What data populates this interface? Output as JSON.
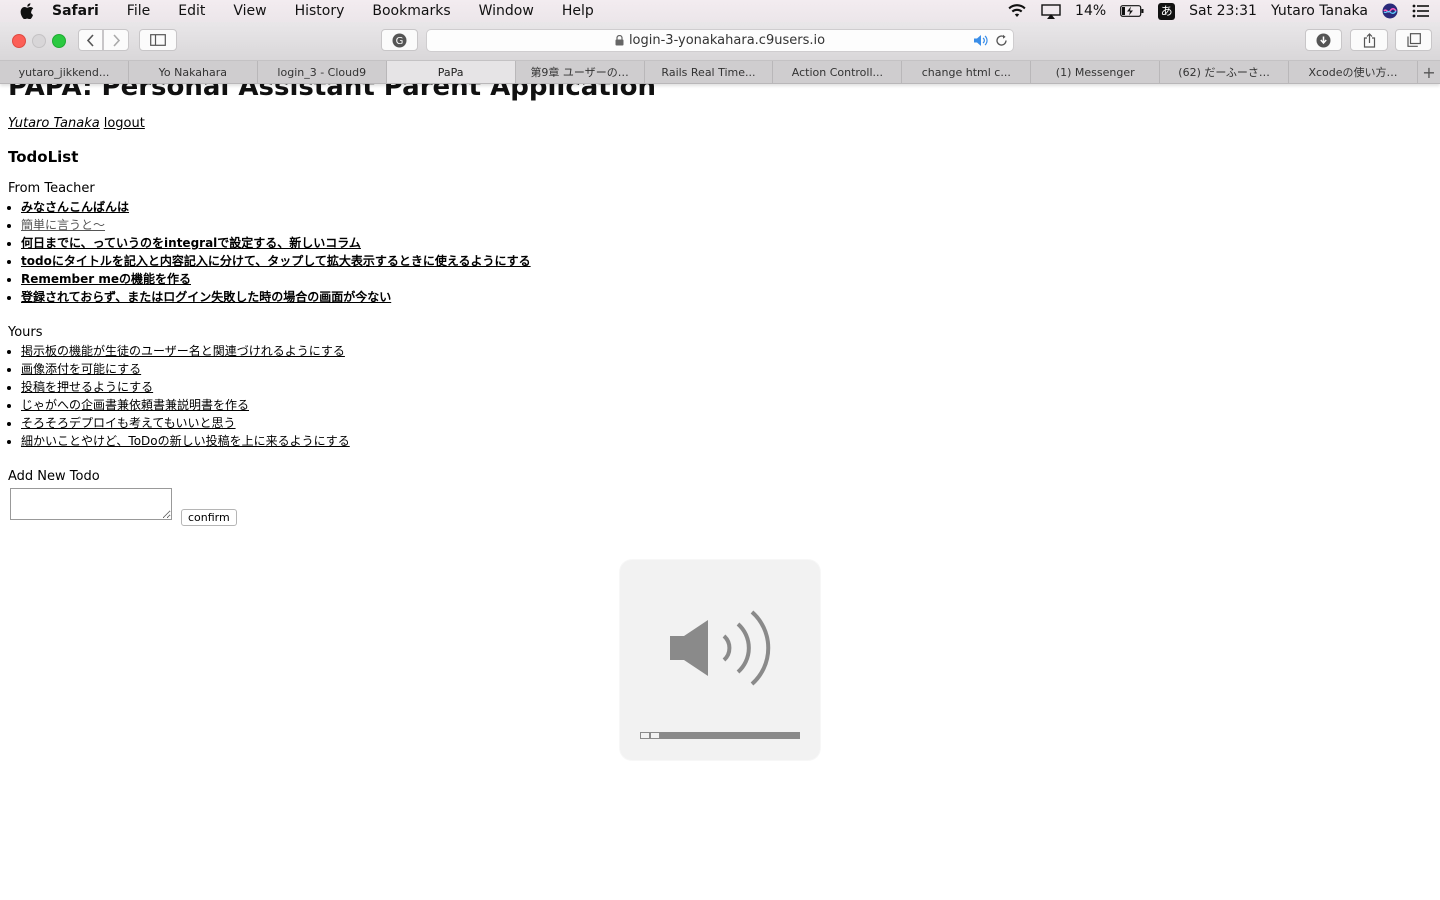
{
  "menubar": {
    "app_name": "Safari",
    "items": [
      "File",
      "Edit",
      "View",
      "History",
      "Bookmarks",
      "Window",
      "Help"
    ],
    "battery": "14%",
    "input_method": "あ",
    "clock": "Sat 23:31",
    "user": "Yutaro Tanaka"
  },
  "browser": {
    "url": "login-3-yonakahara.c9users.io",
    "tabs": [
      {
        "label": "yutaro_jikkend..."
      },
      {
        "label": "Yo Nakahara"
      },
      {
        "label": "login_3 - Cloud9"
      },
      {
        "label": "PaPa"
      },
      {
        "label": "第9章 ユーザーの…"
      },
      {
        "label": "Rails Real Time..."
      },
      {
        "label": "Action Controll..."
      },
      {
        "label": "change html c..."
      },
      {
        "label": "(1) Messenger"
      },
      {
        "label": "(62) だーふーさ…"
      },
      {
        "label": "Xcodeの使い方…"
      }
    ],
    "active_tab": 3,
    "add_tab": "+"
  },
  "page": {
    "title": "PAPA: Personal Assistant Parent Application",
    "user_link": "Yutaro Tanaka",
    "logout_link": "logout",
    "section_title": "TodoList",
    "from_teacher_label": "From Teacher",
    "teacher_todos": [
      "みなさんこんばんは",
      "簡単に言うと〜",
      "何日までに、っていうのをintegralで設定する、新しいコラム",
      "todoにタイトルを記入と内容記入に分けて、タップして拡大表示するときに使えるようにする",
      "Remember meの機能を作る",
      "登録されておらず、またはログイン失敗した時の場合の画面が今ない"
    ],
    "yours_label": "Yours",
    "your_todos": [
      "掲示板の機能が生徒のユーザー名と関連づけれるようにする",
      "画像添付を可能にする",
      "投稿を押せるようにする",
      "じゃがへの企画書兼依頼書兼説明書を作る",
      "そろそろデプロイも考えてもいいと思う",
      "細かいことやけど、ToDoの新しい投稿を上に来るようにする"
    ],
    "add_label": "Add New Todo",
    "new_todo_value": "",
    "confirm_label": "confirm"
  },
  "volume_hud": {
    "level_fraction": 0.13
  }
}
